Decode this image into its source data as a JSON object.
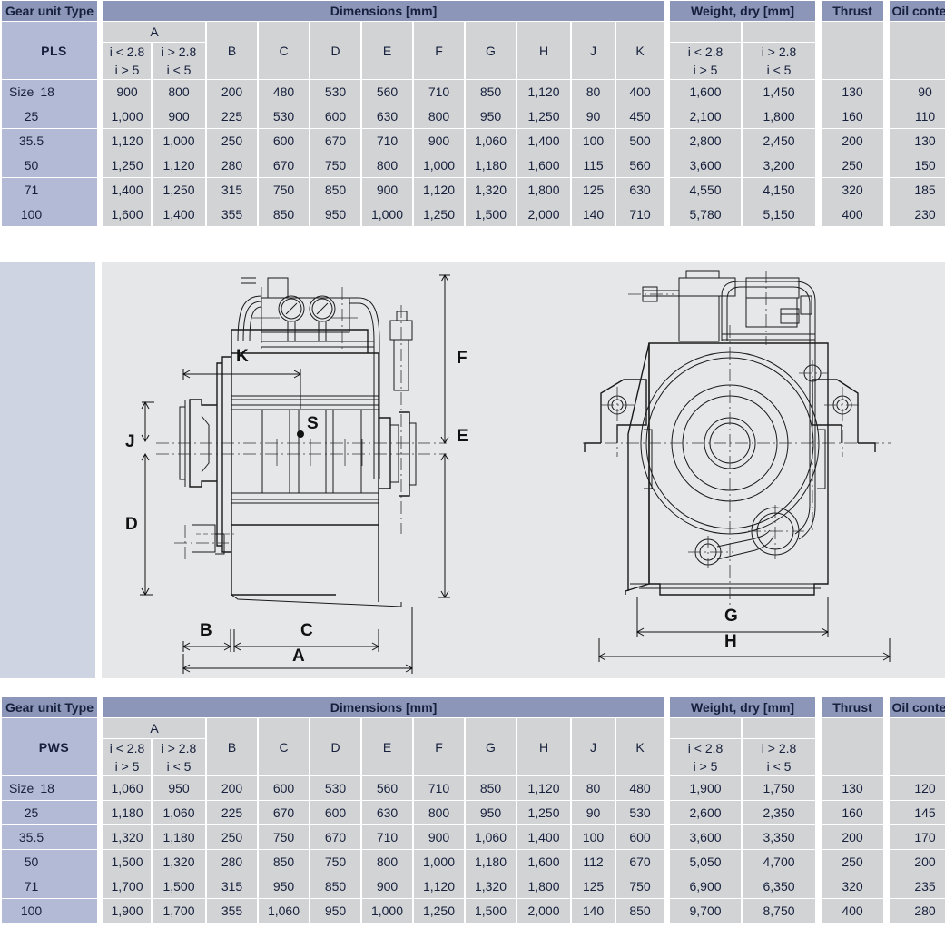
{
  "tables": [
    {
      "id": "pls",
      "type_header": "Gear unit Type",
      "type_name": "PLS",
      "group_dimensions": "Dimensions [mm]",
      "group_weight": "Weight, dry [mm]",
      "col_thrust": "Thrust",
      "col_oil": "Oil content",
      "size_label": "Size",
      "ratio_left_top": "i < 2.8",
      "ratio_left_bottom": "i > 5",
      "ratio_right_top": "i > 2.8",
      "ratio_right_bottom": "i < 5",
      "letters": [
        "A",
        "B",
        "C",
        "D",
        "E",
        "F",
        "G",
        "H",
        "J",
        "K"
      ],
      "sizes": [
        "18",
        "25",
        "35.5",
        "50",
        "71",
        "100"
      ],
      "rows": [
        {
          "size": "18",
          "A1": "900",
          "A2": "800",
          "B": "200",
          "C": "480",
          "D": "530",
          "E": "560",
          "F": "710",
          "G": "850",
          "H": "1,120",
          "J": "80",
          "K": "400",
          "W1": "1,600",
          "W2": "1,450",
          "T": "130",
          "O": "90"
        },
        {
          "size": "25",
          "A1": "1,000",
          "A2": "900",
          "B": "225",
          "C": "530",
          "D": "600",
          "E": "630",
          "F": "800",
          "G": "950",
          "H": "1,250",
          "J": "90",
          "K": "450",
          "W1": "2,100",
          "W2": "1,800",
          "T": "160",
          "O": "110"
        },
        {
          "size": "35.5",
          "A1": "1,120",
          "A2": "1,000",
          "B": "250",
          "C": "600",
          "D": "670",
          "E": "710",
          "F": "900",
          "G": "1,060",
          "H": "1,400",
          "J": "100",
          "K": "500",
          "W1": "2,800",
          "W2": "2,450",
          "T": "200",
          "O": "130"
        },
        {
          "size": "50",
          "A1": "1,250",
          "A2": "1,120",
          "B": "280",
          "C": "670",
          "D": "750",
          "E": "800",
          "F": "1,000",
          "G": "1,180",
          "H": "1,600",
          "J": "115",
          "K": "560",
          "W1": "3,600",
          "W2": "3,200",
          "T": "250",
          "O": "150"
        },
        {
          "size": "71",
          "A1": "1,400",
          "A2": "1,250",
          "B": "315",
          "C": "750",
          "D": "850",
          "E": "900",
          "F": "1,120",
          "G": "1,320",
          "H": "1,800",
          "J": "125",
          "K": "630",
          "W1": "4,550",
          "W2": "4,150",
          "T": "320",
          "O": "185"
        },
        {
          "size": "100",
          "A1": "1,600",
          "A2": "1,400",
          "B": "355",
          "C": "850",
          "D": "950",
          "E": "1,000",
          "F": "1,250",
          "G": "1,500",
          "H": "2,000",
          "J": "140",
          "K": "710",
          "W1": "5,780",
          "W2": "5,150",
          "T": "400",
          "O": "230"
        }
      ]
    },
    {
      "id": "pws",
      "type_header": "Gear unit Type",
      "type_name": "PWS",
      "group_dimensions": "Dimensions [mm]",
      "group_weight": "Weight, dry [mm]",
      "col_thrust": "Thrust",
      "col_oil": "Oil content",
      "size_label": "Size",
      "ratio_left_top": "i < 2.8",
      "ratio_left_bottom": "i > 5",
      "ratio_right_top": "i > 2.8",
      "ratio_right_bottom": "i < 5",
      "letters": [
        "A",
        "B",
        "C",
        "D",
        "E",
        "F",
        "G",
        "H",
        "J",
        "K"
      ],
      "sizes": [
        "18",
        "25",
        "35.5",
        "50",
        "71",
        "100"
      ],
      "rows": [
        {
          "size": "18",
          "A1": "1,060",
          "A2": "950",
          "B": "200",
          "C": "600",
          "D": "530",
          "E": "560",
          "F": "710",
          "G": "850",
          "H": "1,120",
          "J": "80",
          "K": "480",
          "W1": "1,900",
          "W2": "1,750",
          "T": "130",
          "O": "120"
        },
        {
          "size": "25",
          "A1": "1,180",
          "A2": "1,060",
          "B": "225",
          "C": "670",
          "D": "600",
          "E": "630",
          "F": "800",
          "G": "950",
          "H": "1,250",
          "J": "90",
          "K": "530",
          "W1": "2,600",
          "W2": "2,350",
          "T": "160",
          "O": "145"
        },
        {
          "size": "35.5",
          "A1": "1,320",
          "A2": "1,180",
          "B": "250",
          "C": "750",
          "D": "670",
          "E": "710",
          "F": "900",
          "G": "1,060",
          "H": "1,400",
          "J": "100",
          "K": "600",
          "W1": "3,600",
          "W2": "3,350",
          "T": "200",
          "O": "170"
        },
        {
          "size": "50",
          "A1": "1,500",
          "A2": "1,320",
          "B": "280",
          "C": "850",
          "D": "750",
          "E": "800",
          "F": "1,000",
          "G": "1,180",
          "H": "1,600",
          "J": "112",
          "K": "670",
          "W1": "5,050",
          "W2": "4,700",
          "T": "250",
          "O": "200"
        },
        {
          "size": "71",
          "A1": "1,700",
          "A2": "1,500",
          "B": "315",
          "C": "950",
          "D": "850",
          "E": "900",
          "F": "1,120",
          "G": "1,320",
          "H": "1,800",
          "J": "125",
          "K": "750",
          "W1": "6,900",
          "W2": "6,350",
          "T": "320",
          "O": "235"
        },
        {
          "size": "100",
          "A1": "1,900",
          "A2": "1,700",
          "B": "355",
          "C": "1,060",
          "D": "950",
          "E": "1,000",
          "F": "1,250",
          "G": "1,500",
          "H": "2,000",
          "J": "140",
          "K": "850",
          "W1": "9,700",
          "W2": "8,750",
          "T": "400",
          "O": "280"
        }
      ]
    }
  ],
  "drawing": {
    "side_view_labels": [
      "A",
      "B",
      "C",
      "D",
      "E",
      "F",
      "J",
      "K",
      "S"
    ],
    "front_view_labels": [
      "G",
      "H"
    ],
    "label_A": "A",
    "label_B": "B",
    "label_C": "C",
    "label_D": "D",
    "label_E": "E",
    "label_F": "F",
    "label_J": "J",
    "label_K": "K",
    "label_S": "S",
    "label_G": "G",
    "label_H": "H"
  },
  "colors": {
    "header_blue": "#8b96b9",
    "name_blue": "#b3bad5",
    "cell_gray": "#d2d3d5",
    "drawing_bg": "#e6e7e9",
    "side_panel": "#cfd4e3",
    "text_dark": "#16203c"
  }
}
